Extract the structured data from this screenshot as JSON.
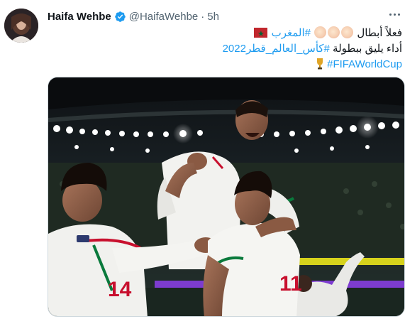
{
  "author": {
    "name": "Haifa Wehbe",
    "handle": "@HaifaWehbe",
    "separator": "·",
    "time": "5h",
    "verified": true
  },
  "tweet": {
    "line1_text": "فعلاً أبطال",
    "line1_hashtag": "#المغرب",
    "line2_text": "أداء يليق ببطولة",
    "line2_hashtag": "#كأس_العالم_قطر2022",
    "line3_hashtag": "#FIFAWorldCup"
  },
  "icons": {
    "verified": "verified-badge-icon",
    "more": "more-options-icon",
    "clap": "clapping-hands-emoji",
    "flag": "morocco-flag-emoji",
    "trophy": "trophy-emoji"
  },
  "media": {
    "players": [
      {
        "shirt_number": "14"
      },
      {
        "shirt_number": "11"
      }
    ]
  },
  "colors": {
    "hashtag": "#1d9bf0",
    "text": "#0f1419",
    "secondary": "#536471",
    "verified": "#1d9bf0",
    "jersey": "#f4f4f2",
    "jersey_trim_red": "#c8102e",
    "jersey_trim_green": "#0a7a3c"
  }
}
